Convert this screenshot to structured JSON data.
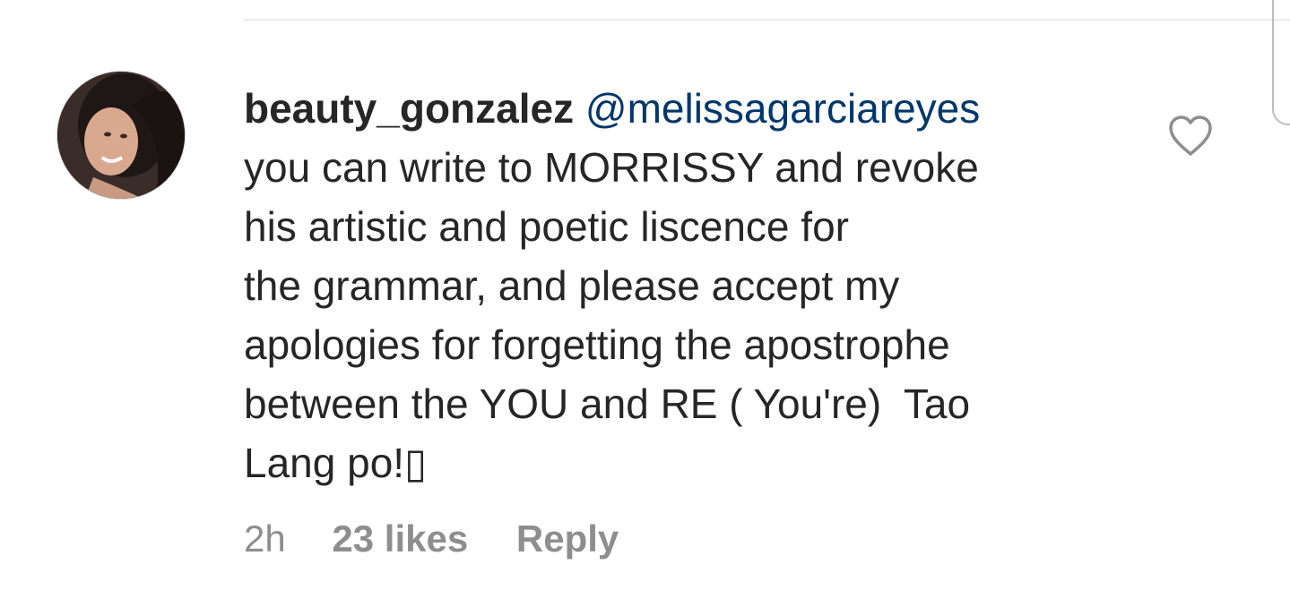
{
  "comment": {
    "username": "beauty_gonzalez",
    "mention": "@melissagarciareyes",
    "lines": [
      "you can write to MORRISSY and revoke",
      "his artistic and poetic liscence for",
      "the grammar, and please accept my",
      "apologies for forgetting the apostrophe",
      "between the YOU and RE ( You're)  Tao",
      "Lang po!▯"
    ],
    "time": "2h",
    "likes": "23 likes",
    "reply_label": "Reply"
  },
  "icons": {
    "like": "heart-outline-icon",
    "avatar": "profile-photo"
  },
  "colors": {
    "text": "#262626",
    "mention": "#00376b",
    "meta": "#8e8e8e",
    "heart": "#8e8e8e"
  }
}
